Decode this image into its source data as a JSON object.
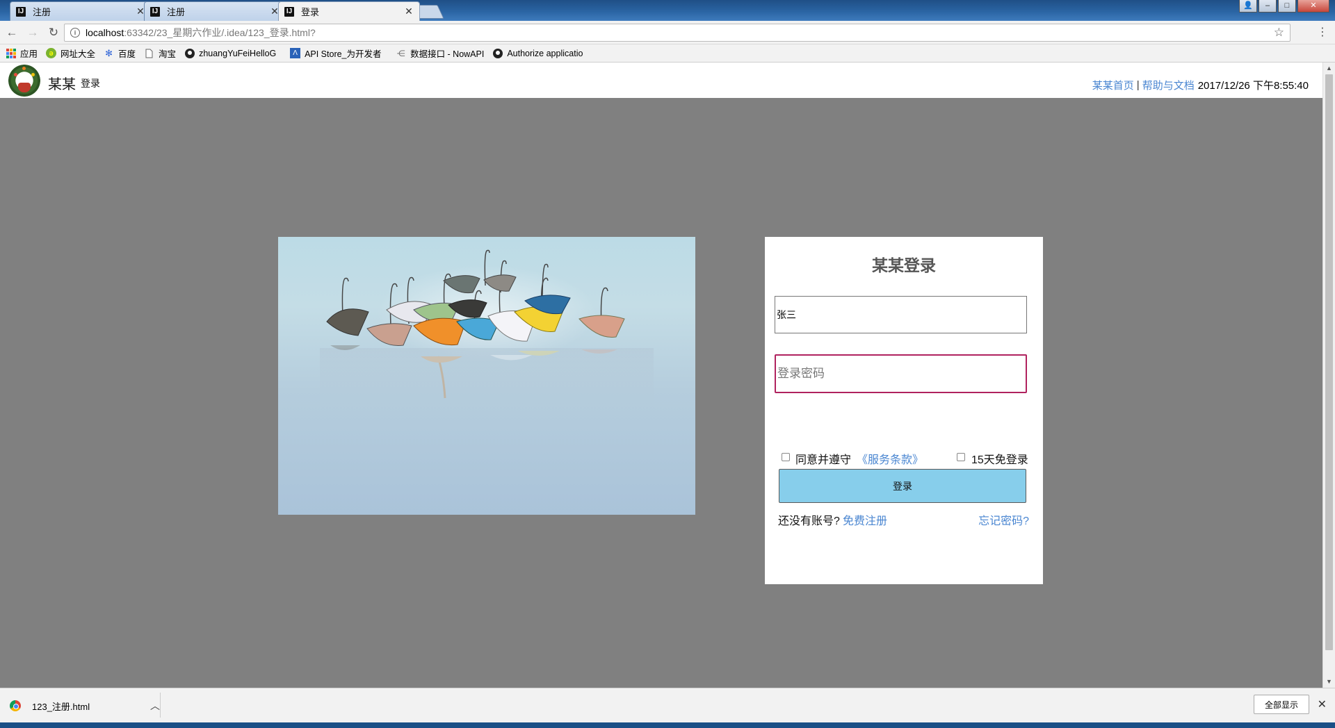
{
  "browser": {
    "tabs": [
      {
        "title": "注册",
        "active": false
      },
      {
        "title": "注册",
        "active": false
      },
      {
        "title": "登录",
        "active": true
      }
    ],
    "tab_icon": "IJ",
    "url_host": "localhost",
    "url_path": ":63342/23_星期六作业/.idea/123_登录.html?",
    "bookmarks": [
      {
        "label": "应用",
        "icon": "apps-grid-icon"
      },
      {
        "label": "网址大全",
        "icon": "hao123-icon"
      },
      {
        "label": "百度",
        "icon": "baidu-paw-icon"
      },
      {
        "label": "淘宝",
        "icon": "page-icon"
      },
      {
        "label": "zhuangYuFeiHelloG",
        "icon": "github-icon"
      },
      {
        "label": "API Store_为开发者",
        "icon": "api-store-icon"
      },
      {
        "label": "数据接口 - NowAPI",
        "icon": "share-nodes-icon"
      },
      {
        "label": "Authorize applicatio",
        "icon": "github-icon"
      }
    ]
  },
  "header": {
    "brand": "某某",
    "brand_sub": "登录",
    "nav_home": "某某首页",
    "separator": "|",
    "nav_help": "帮助与文档",
    "datetime": "2017/12/26 下午8:55:40"
  },
  "login": {
    "title": "某某登录",
    "username_value": "张三",
    "password_placeholder": "登录密码",
    "agree_label": "同意并遵守",
    "terms_link": "《服务条款》",
    "remember_label": "15天免登录",
    "submit_label": "登录",
    "no_account_text": "还没有账号?",
    "register_link": "免费注册",
    "forgot_link": "忘记密码?"
  },
  "downloads": {
    "file_name": "123_注册.html",
    "show_all_label": "全部显示"
  },
  "colors": {
    "page_bg": "#808080",
    "link": "#4a86d1",
    "login_button": "#87ceeb",
    "password_focus_border": "#b0225e"
  }
}
